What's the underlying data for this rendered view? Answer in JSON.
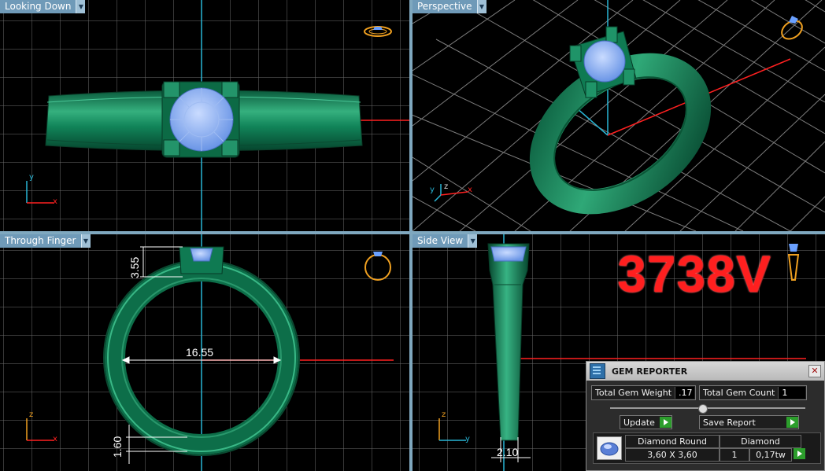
{
  "viewports": {
    "top_left": {
      "label": "Looking Down"
    },
    "top_right": {
      "label": "Perspective"
    },
    "bottom_left": {
      "label": "Through Finger"
    },
    "bottom_right": {
      "label": "Side View"
    }
  },
  "axes": {
    "top_left": {
      "a": "y",
      "b": "x"
    },
    "top_right": {
      "a": "z",
      "b": "y",
      "c": "x"
    },
    "bottom_left": {
      "a": "z",
      "b": "x"
    },
    "bottom_right": {
      "a": "z",
      "b": "y"
    }
  },
  "dimensions": {
    "prong_height": "3.55",
    "inner_diameter": "16.55",
    "band_thickness": "1.60",
    "band_width": "2.10"
  },
  "product_code": "3738V",
  "gem_reporter": {
    "title": "GEM REPORTER",
    "total_weight_label": "Total Gem Weight",
    "total_weight_value": ".17",
    "total_count_label": "Total Gem Count",
    "total_count_value": "1",
    "update_label": "Update",
    "save_report_label": "Save Report",
    "gem": {
      "shape": "Diamond Round",
      "type": "Diamond",
      "size": "3,60 X 3,60",
      "count": "1",
      "weight": "0,17tw"
    }
  },
  "colors": {
    "ring": "#0f7a52",
    "gem": "#8fb6f2",
    "grid": "#6e6e6e",
    "axis_red": "#ff2020",
    "axis_cyan": "#29b6d6",
    "code_red": "#ff1f1f"
  }
}
